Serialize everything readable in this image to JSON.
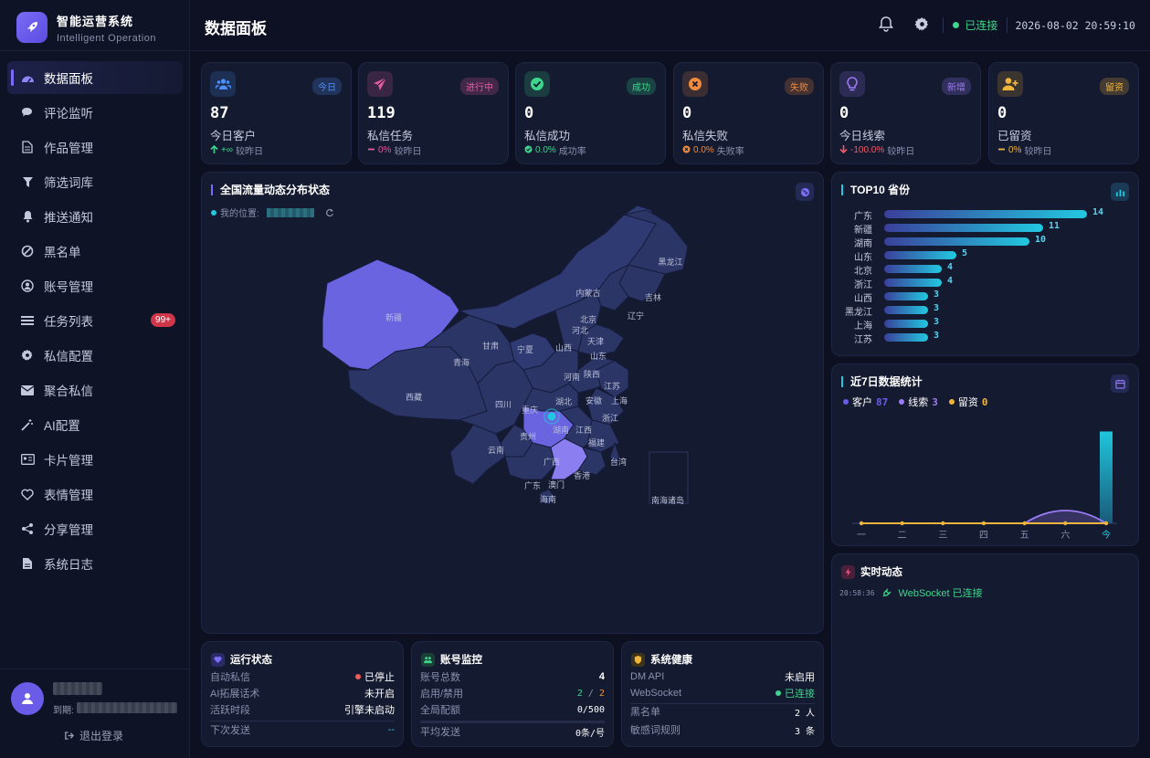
{
  "brand": {
    "title": "智能运营系统",
    "subtitle": "Intelligent Operation"
  },
  "nav": [
    {
      "label": "数据面板",
      "icon": "dashboard-icon",
      "active": true
    },
    {
      "label": "评论监听",
      "icon": "comments-icon"
    },
    {
      "label": "作品管理",
      "icon": "file-icon"
    },
    {
      "label": "筛选词库",
      "icon": "filter-icon"
    },
    {
      "label": "推送通知",
      "icon": "bell-icon"
    },
    {
      "label": "黑名单",
      "icon": "ban-icon"
    },
    {
      "label": "账号管理",
      "icon": "user-circle-icon"
    },
    {
      "label": "任务列表",
      "icon": "list-icon",
      "badge": "99+"
    },
    {
      "label": "私信配置",
      "icon": "gear-icon"
    },
    {
      "label": "聚合私信",
      "icon": "envelope-icon"
    },
    {
      "label": "AI配置",
      "icon": "magic-wand-icon"
    },
    {
      "label": "卡片管理",
      "icon": "id-card-icon"
    },
    {
      "label": "表情管理",
      "icon": "heart-icon"
    },
    {
      "label": "分享管理",
      "icon": "share-icon"
    },
    {
      "label": "系统日志",
      "icon": "log-file-icon"
    }
  ],
  "user": {
    "expire_label": "到期:",
    "logout": "退出登录"
  },
  "header": {
    "title": "数据面板",
    "connection": "已连接",
    "datetime": "2026-08-02 20:59:10",
    "colors": {
      "connected": "#3dd68c"
    }
  },
  "stats": [
    {
      "value": "87",
      "label": "今日客户",
      "tag": "今日",
      "cmp_value": "+∞",
      "cmp_text": "较昨日",
      "icon": "users-icon",
      "color": "#4f8ef7",
      "cmp_color": "#3dd68c",
      "cmp_icon": "arrow-up-icon"
    },
    {
      "value": "119",
      "label": "私信任务",
      "tag": "进行中",
      "cmp_value": "0%",
      "cmp_text": "较昨日",
      "icon": "paper-plane-icon",
      "color": "#e25ca4",
      "cmp_color": "#e25ca4",
      "cmp_icon": "dash-icon"
    },
    {
      "value": "0",
      "label": "私信成功",
      "tag": "成功",
      "cmp_value": "0.0%",
      "cmp_text": "成功率",
      "icon": "check-circle-icon",
      "color": "#3dd68c",
      "cmp_color": "#3dd68c",
      "cmp_icon": "check-icon"
    },
    {
      "value": "0",
      "label": "私信失败",
      "tag": "失败",
      "cmp_value": "0.0%",
      "cmp_text": "失败率",
      "icon": "x-circle-icon",
      "color": "#f08a3c",
      "cmp_color": "#f08a3c",
      "cmp_icon": "x-icon"
    },
    {
      "value": "0",
      "label": "今日线索",
      "tag": "新增",
      "cmp_value": "-100.0%",
      "cmp_text": "较昨日",
      "icon": "lightbulb-icon",
      "color": "#9b7bf6",
      "cmp_color": "#f05a6a",
      "cmp_icon": "arrow-down-icon"
    },
    {
      "value": "0",
      "label": "已留资",
      "tag": "留资",
      "cmp_value": "0%",
      "cmp_text": "较昨日",
      "icon": "user-plus-icon",
      "color": "#f0b43c",
      "cmp_color": "#f0b43c",
      "cmp_icon": "dash-icon"
    }
  ],
  "map": {
    "title": "全国流量动态分布状态",
    "location_label": "我的位置:",
    "provinces": [
      "黑龙江",
      "吉林",
      "辽宁",
      "内蒙古",
      "北京",
      "河北",
      "天津",
      "山西",
      "山东",
      "宁夏",
      "甘肃",
      "新疆",
      "青海",
      "西藏",
      "陕西",
      "河南",
      "江苏",
      "安徽",
      "上海",
      "四川",
      "重庆",
      "湖北",
      "浙江",
      "湖南",
      "江西",
      "贵州",
      "福建",
      "云南",
      "广西",
      "广东",
      "台湾",
      "香港",
      "澳门",
      "海南",
      "南海诸岛"
    ]
  },
  "top10": {
    "title": "TOP10 省份",
    "rows": [
      {
        "name": "广东",
        "value": 14
      },
      {
        "name": "新疆",
        "value": 11
      },
      {
        "name": "湖南",
        "value": 10
      },
      {
        "name": "山东",
        "value": 5
      },
      {
        "name": "北京",
        "value": 4
      },
      {
        "name": "浙江",
        "value": 4
      },
      {
        "name": "山西",
        "value": 3
      },
      {
        "name": "黑龙江",
        "value": 3
      },
      {
        "name": "上海",
        "value": 3
      },
      {
        "name": "江苏",
        "value": 3
      }
    ]
  },
  "chart_data": {
    "type": "bar",
    "title": "近7日数据统计",
    "categories": [
      "一",
      "二",
      "三",
      "四",
      "五",
      "六",
      "今"
    ],
    "series": [
      {
        "name": "客户",
        "values": [
          0,
          0,
          0,
          0,
          0,
          0,
          87
        ],
        "total": "87",
        "color": "#6a5ce8"
      },
      {
        "name": "线索",
        "values": [
          0,
          0,
          0,
          0,
          0,
          3,
          0
        ],
        "total": "3",
        "color": "#9b7bf6"
      },
      {
        "name": "留资",
        "values": [
          0,
          0,
          0,
          0,
          0,
          0,
          0
        ],
        "total": "0",
        "color": "#f0b43c"
      }
    ],
    "ylim": [
      0,
      90
    ],
    "grid": false,
    "legend": "top-left"
  },
  "realtime": {
    "title": "实时动态",
    "events": [
      {
        "time": "20:58:36",
        "text": "WebSocket 已连接"
      }
    ]
  },
  "run_status": {
    "title": "运行状态",
    "rows": [
      {
        "label": "自动私信",
        "value": "已停止"
      },
      {
        "label": "AI拓展话术",
        "value": "未开启"
      },
      {
        "label": "活跃时段",
        "value": "引擎未启动"
      },
      {
        "label": "下次发送",
        "value": "--"
      }
    ]
  },
  "account_monitor": {
    "title": "账号监控",
    "rows": [
      {
        "label": "账号总数",
        "value": "4"
      },
      {
        "label": "启用/禁用",
        "value_a": "2",
        "sep": "/",
        "value_b": "2"
      },
      {
        "label": "全局配额",
        "value": "0/500"
      },
      {
        "label": "平均发送",
        "value": "0条/号"
      }
    ]
  },
  "system_health": {
    "title": "系统健康",
    "rows": [
      {
        "label": "DM API",
        "value": "未启用"
      },
      {
        "label": "WebSocket",
        "value": "已连接"
      },
      {
        "label": "黑名单",
        "value": "2 人"
      },
      {
        "label": "敏感词规则",
        "value": "3 条"
      }
    ]
  }
}
